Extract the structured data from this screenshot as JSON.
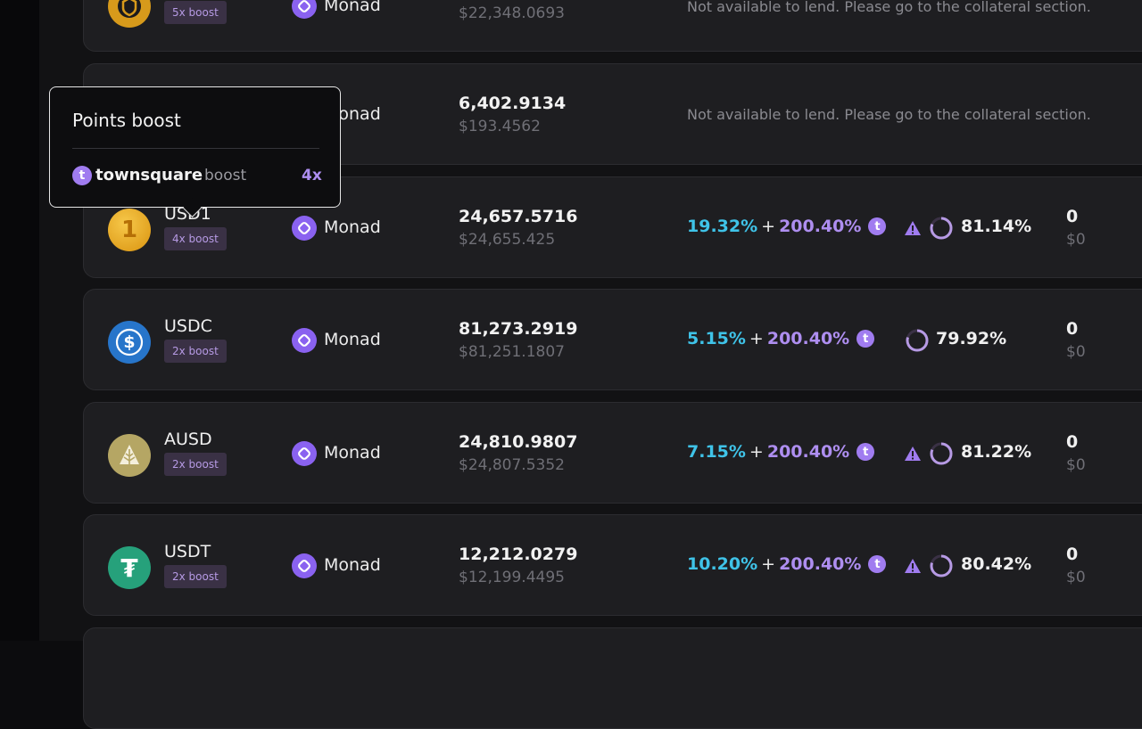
{
  "colors": {
    "accent_purple": "#ae8ef0",
    "apy_cyan": "#3fc3e8",
    "badge_bg": "#3a3145",
    "row_bg": "#1e1e21"
  },
  "tooltip": {
    "title": "Points boost",
    "brand_logo_letter": "t",
    "brand": "townsquare",
    "label": "boost",
    "multiplier": "4x"
  },
  "rows": [
    {
      "asset": "",
      "boost": "5x boost",
      "network": "Monad",
      "amount": "",
      "usd": "$22,348.0693",
      "notice": "Not available to lend. Please go to the collateral section.",
      "icon": "coin-shield-icon"
    },
    {
      "asset": "",
      "boost": "",
      "network": "Monad",
      "amount": "6,402.9134",
      "usd": "$193.4562",
      "notice": "Not available to lend. Please go to the collateral section."
    },
    {
      "asset": "USD1",
      "boost": "4x boost",
      "network": "Monad",
      "amount": "24,657.5716",
      "usd": "$24,655.425",
      "apy": "19.32%",
      "plus": "+",
      "boost_apy": "200.40%",
      "t": "t",
      "ltv": "81.14%",
      "lent": "0",
      "lent_usd": "$0",
      "icon": "usd1-icon",
      "icon_glyph": "1",
      "warning": true
    },
    {
      "asset": "USDC",
      "boost": "2x boost",
      "network": "Monad",
      "amount": "81,273.2919",
      "usd": "$81,251.1807",
      "apy": "5.15%",
      "plus": "+",
      "boost_apy": "200.40%",
      "t": "t",
      "ltv": "79.92%",
      "lent": "0",
      "lent_usd": "$0",
      "icon": "usdc-icon",
      "icon_glyph": "$",
      "warning": false
    },
    {
      "asset": "AUSD",
      "boost": "2x boost",
      "network": "Monad",
      "amount": "24,810.9807",
      "usd": "$24,807.5352",
      "apy": "7.15%",
      "plus": "+",
      "boost_apy": "200.40%",
      "t": "t",
      "ltv": "81.22%",
      "lent": "0",
      "lent_usd": "$0",
      "icon": "ausd-icon",
      "warning": true
    },
    {
      "asset": "USDT",
      "boost": "2x boost",
      "network": "Monad",
      "amount": "12,212.0279",
      "usd": "$12,199.4495",
      "apy": "10.20%",
      "plus": "+",
      "boost_apy": "200.40%",
      "t": "t",
      "ltv": "80.42%",
      "lent": "0",
      "lent_usd": "$0",
      "icon": "usdt-icon",
      "icon_glyph": "₮",
      "warning": true
    }
  ]
}
